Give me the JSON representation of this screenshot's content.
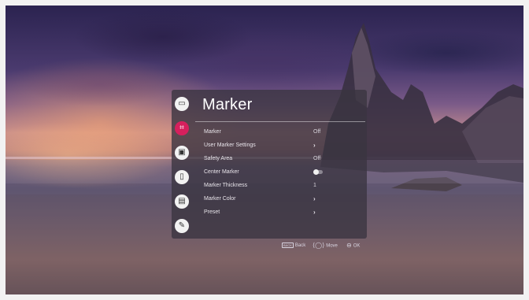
{
  "menu": {
    "title": "Marker",
    "items": [
      {
        "label": "Marker",
        "value": "Off",
        "control": "value"
      },
      {
        "label": "User Marker Settings",
        "value": "›",
        "control": "chevron"
      },
      {
        "label": "Safety Area",
        "value": "Off",
        "control": "value"
      },
      {
        "label": "Center Marker",
        "value": "off",
        "control": "toggle"
      },
      {
        "label": "Marker Thickness",
        "value": "1",
        "control": "value"
      },
      {
        "label": "Marker Color",
        "value": "›",
        "control": "chevron"
      },
      {
        "label": "Preset",
        "value": "›",
        "control": "chevron"
      }
    ]
  },
  "sidebar": {
    "icons": [
      {
        "name": "picture-icon",
        "glyph": "▭",
        "active": false
      },
      {
        "name": "marker-icon",
        "glyph": "⌗",
        "active": true
      },
      {
        "name": "sound-icon",
        "glyph": "▣",
        "active": false
      },
      {
        "name": "remote-icon",
        "glyph": "▯",
        "active": false
      },
      {
        "name": "general-icon",
        "glyph": "▤",
        "active": false
      },
      {
        "name": "support-icon",
        "glyph": "✎",
        "active": false
      }
    ]
  },
  "guide": {
    "back_key": "BACK",
    "back_label": "Back",
    "move_label": "Move",
    "ok_label": "OK"
  },
  "colors": {
    "accent": "#d6205d",
    "panel_bg": "#3a3440"
  }
}
